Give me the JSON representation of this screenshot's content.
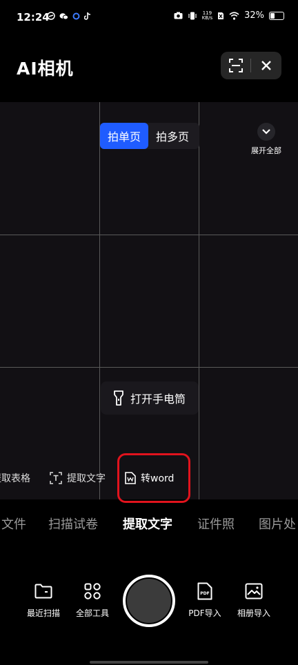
{
  "status_bar": {
    "time": "12:24",
    "net_speed_top": "119",
    "net_speed_bottom": "KB/s",
    "battery": "32%"
  },
  "header": {
    "title": "AI相机"
  },
  "viewfinder": {
    "page_toggle": [
      "拍单页",
      "拍多页"
    ],
    "expand_label": "展开全部",
    "torch_label": "打开手电筒",
    "sub_tabs": [
      "提取表格",
      "提取文字",
      "转word"
    ]
  },
  "mode_tabs": [
    "文件",
    "扫描试卷",
    "提取文字",
    "证件照",
    "图片处"
  ],
  "bottom_tools": {
    "recent_scan": "最近扫描",
    "all_tools": "全部工具",
    "pdf_import": "PDF导入",
    "album_import": "相册导入"
  },
  "colors": {
    "accent": "#1f5cff",
    "highlight": "#e1131d"
  }
}
